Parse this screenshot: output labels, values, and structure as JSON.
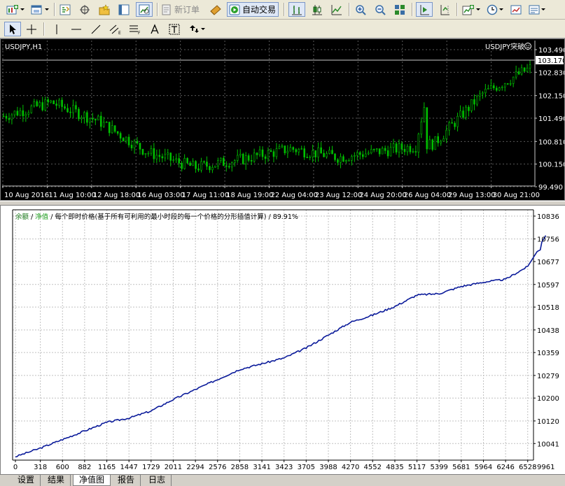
{
  "toolbar": {
    "new_order_label": "新订单",
    "auto_trading_label": "自动交易"
  },
  "price_chart": {
    "symbol_title": "USDJPY,H1",
    "ea_label": "USDJPY突破",
    "current_price": "103.170",
    "y_labels": [
      "103.490",
      "102.830",
      "102.150",
      "101.490",
      "100.810",
      "100.150",
      "99.490"
    ],
    "x_labels": [
      "10 Aug 2016",
      "11 Aug 10:00",
      "12 Aug 18:00",
      "16 Aug 03:00",
      "17 Aug 11:00",
      "18 Aug 19:00",
      "22 Aug 04:00",
      "23 Aug 12:00",
      "24 Aug 20:00",
      "26 Aug 04:00",
      "29 Aug 13:00",
      "30 Aug 21:00"
    ],
    "colors": {
      "background": "#000000",
      "candles": "#00c000",
      "grid": "#5a5a5a",
      "text": "#ffffff"
    }
  },
  "equity_chart": {
    "legend_balance": "余额",
    "legend_sep1": " / ",
    "legend_equity": "净值",
    "legend_sep2": " / ",
    "legend_desc": "每个即时价格(基于所有可利用的最小时段的每一个价格的分形插值计算)",
    "legend_sep3": " / ",
    "legend_quality": "89.91%",
    "y_labels": [
      "10836",
      "10756",
      "10677",
      "10597",
      "10518",
      "10438",
      "10359",
      "10279",
      "10200",
      "10120",
      "10041",
      "9961"
    ],
    "x_labels": [
      "0",
      "318",
      "600",
      "882",
      "1165",
      "1447",
      "1729",
      "2011",
      "2294",
      "2576",
      "2858",
      "3141",
      "3423",
      "3705",
      "3988",
      "4270",
      "4552",
      "4835",
      "5117",
      "5399",
      "5681",
      "5964",
      "6246",
      "6528"
    ],
    "colors": {
      "line": "#0a1a9a",
      "balance": "#1a7a1a",
      "equity": "#20a020",
      "grid": "#c0c0c0"
    }
  },
  "chart_data": [
    {
      "type": "line",
      "title": "USDJPY,H1",
      "x": [
        "10 Aug 2016",
        "11 Aug 10:00",
        "12 Aug 18:00",
        "16 Aug 03:00",
        "17 Aug 11:00",
        "18 Aug 19:00",
        "22 Aug 04:00",
        "23 Aug 12:00",
        "24 Aug 20:00",
        "26 Aug 04:00",
        "29 Aug 13:00",
        "30 Aug 21:00"
      ],
      "series": [
        {
          "values": [
            101.55,
            101.95,
            101.4,
            100.5,
            100.05,
            100.3,
            100.6,
            100.35,
            100.55,
            100.75,
            102.2,
            102.95
          ]
        }
      ],
      "ylim": [
        99.49,
        103.49
      ],
      "grid": true
    },
    {
      "type": "line",
      "x": [
        0,
        318,
        600,
        882,
        1165,
        1447,
        1729,
        2011,
        2294,
        2576,
        2858,
        3141,
        3423,
        3705,
        3988,
        4270,
        4552,
        4835,
        5117,
        5399,
        5681,
        5964,
        6246,
        6528
      ],
      "series": [
        {
          "name": "净值",
          "values": [
            9995,
            10025,
            10055,
            10085,
            10115,
            10130,
            10155,
            10195,
            10230,
            10265,
            10300,
            10320,
            10340,
            10375,
            10420,
            10465,
            10490,
            10520,
            10560,
            10565,
            10590,
            10605,
            10615,
            10660
          ]
        }
      ],
      "ylim": [
        9961,
        10836
      ],
      "grid": true
    }
  ],
  "tabs": [
    "设置",
    "结果",
    "净值图",
    "报告",
    "日志"
  ],
  "active_tab": "净值图"
}
